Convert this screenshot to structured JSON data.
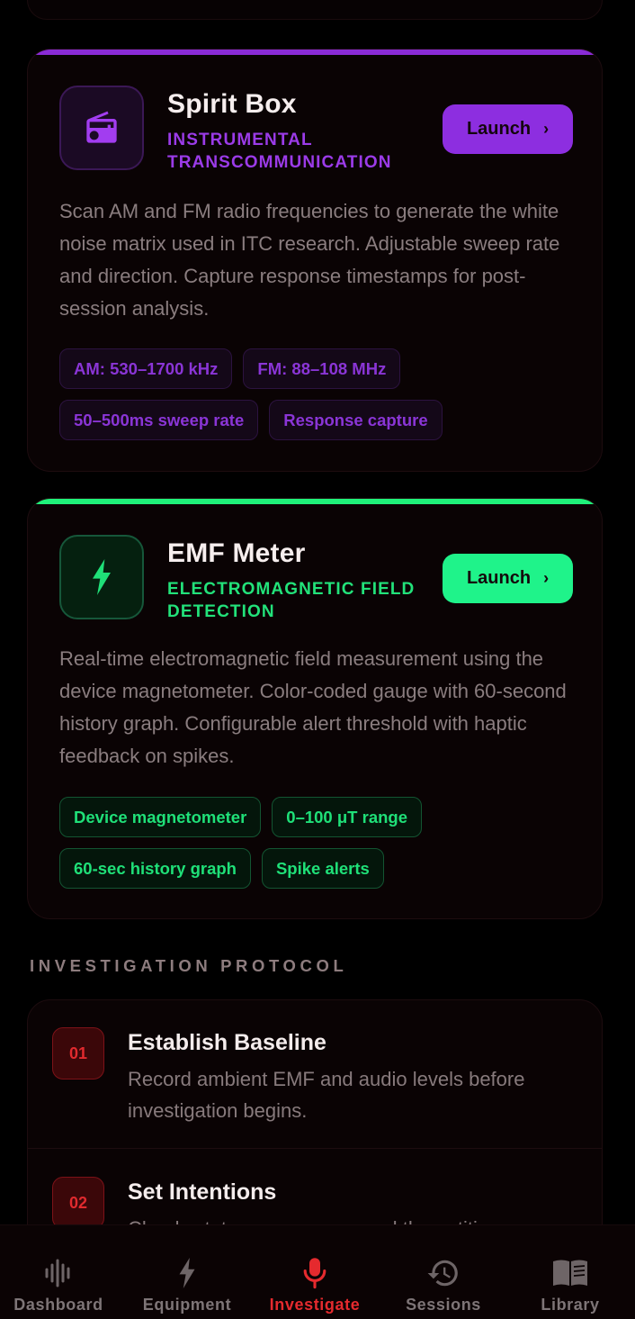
{
  "colors": {
    "background": "#000000",
    "spirit_accent": "#8d2ee0",
    "emf_accent": "#1ff38a",
    "active_tab": "#e52a2e",
    "muted_text": "#8a7d7f"
  },
  "tools": [
    {
      "icon": "radio-icon",
      "title": "Spirit Box",
      "subtitle": "INSTRUMENTAL TRANSCOMMUNICATION",
      "launch_label": "Launch",
      "description": "Scan AM and FM radio frequencies to generate the white noise matrix used in ITC research. Adjustable sweep rate and direction. Capture response timestamps for post-session analysis.",
      "tags": [
        "AM: 530–1700 kHz",
        "FM: 88–108 MHz",
        "50–500ms sweep rate",
        "Response capture"
      ]
    },
    {
      "icon": "lightning-bolt-icon",
      "title": "EMF Meter",
      "subtitle": "ELECTROMAGNETIC FIELD DETECTION",
      "launch_label": "Launch",
      "description": "Real-time electromagnetic field measurement using the device magnetometer. Color-coded gauge with 60-second history graph. Configurable alert threshold with haptic feedback on spikes.",
      "tags": [
        "Device magnetometer",
        "0–100 μT range",
        "60-sec history graph",
        "Spike alerts"
      ]
    }
  ],
  "protocol": {
    "heading": "INVESTIGATION PROTOCOL",
    "steps": [
      {
        "number": "01",
        "title": "Establish Baseline",
        "description": "Record ambient EMF and audio levels before investigation begins."
      },
      {
        "number": "02",
        "title": "Set Intentions",
        "description": "Clearly state your purpose and the entities you"
      }
    ]
  },
  "tabbar": {
    "active": "Investigate",
    "tabs": [
      {
        "label": "Dashboard",
        "icon": "waveform-icon"
      },
      {
        "label": "Equipment",
        "icon": "lightning-bolt-icon"
      },
      {
        "label": "Investigate",
        "icon": "microphone-icon"
      },
      {
        "label": "Sessions",
        "icon": "history-icon"
      },
      {
        "label": "Library",
        "icon": "book-icon"
      }
    ]
  }
}
